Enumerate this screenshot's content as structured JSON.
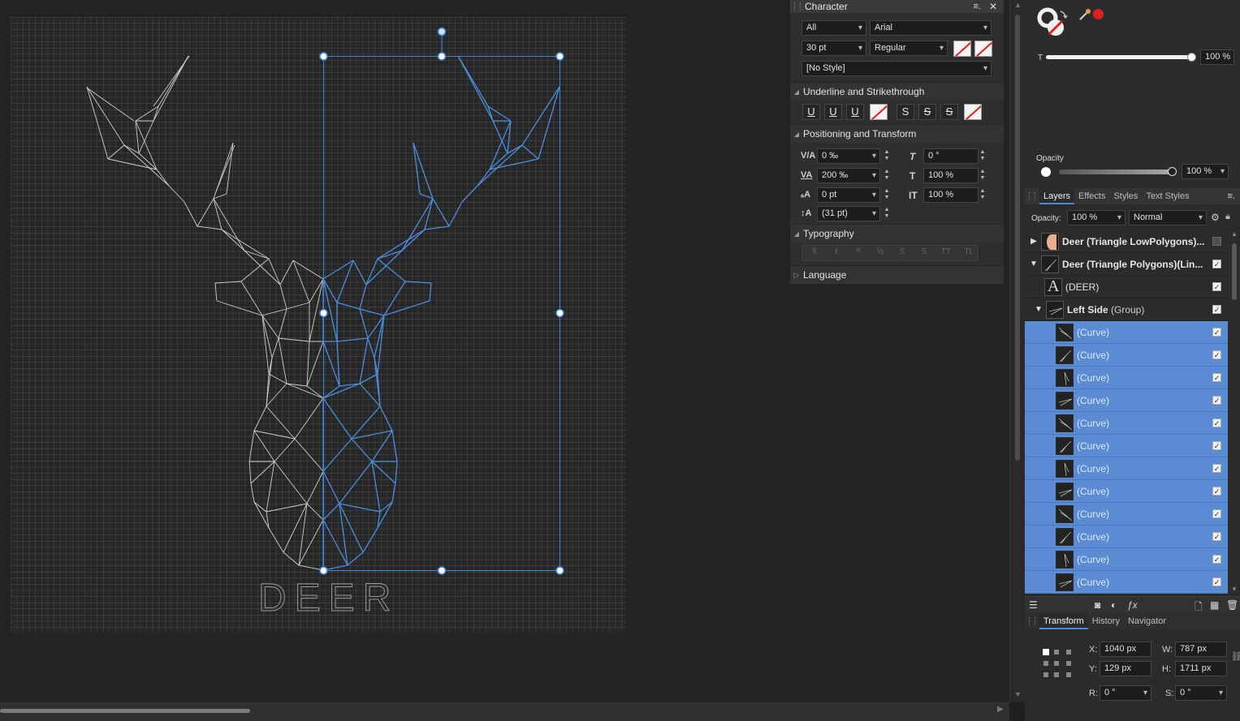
{
  "canvas": {
    "artboard_text": "DEER"
  },
  "character": {
    "title": "Character",
    "scope": "All",
    "font": "Arial",
    "size": "30 pt",
    "weight": "Regular",
    "style": "[No Style]",
    "sections": {
      "underline": "Underline and Strikethrough",
      "positioning": "Positioning and Transform",
      "typography": "Typography",
      "language": "Language"
    },
    "underline_buttons": [
      "U",
      "U",
      "U"
    ],
    "strike_buttons": [
      "S",
      "S",
      "S"
    ],
    "positioning": {
      "tracking": "0 ‰",
      "kerning": "200 ‰",
      "baseline": "0 pt",
      "leading": "(31 pt)",
      "shear": "0 °",
      "vscale": "100 %",
      "hscale": "100 %"
    },
    "typography_buttons": [
      "fi",
      "ℓ",
      "ᴺ",
      "½",
      "S",
      "S",
      "TT",
      "Tt"
    ]
  },
  "color": {
    "accent": "#e02020",
    "tint_label": "T",
    "tint_value": "100 %",
    "tint_level": 1.0,
    "opacity_label": "Opacity",
    "opacity_value": "100 %",
    "opacity_level": 1.0
  },
  "layers": {
    "tabs": [
      "Layers",
      "Effects",
      "Styles",
      "Text Styles"
    ],
    "opacity_label": "Opacity:",
    "opacity_value": "100 %",
    "blend_mode": "Normal",
    "rows": [
      {
        "name": "Deer (Triangle LowPolygons)...",
        "bold": true,
        "expander": "▶",
        "checked": false
      },
      {
        "name": "Deer (Triangle Polygons)(Lin...",
        "bold": true,
        "expander": "▼",
        "checked": true
      },
      {
        "name": "(DEER)",
        "bold": false,
        "expander": "",
        "checked": true
      },
      {
        "name": "Left Side",
        "suffix": " (Group)",
        "bold": true,
        "expander": "▼",
        "checked": true
      },
      {
        "name": "(Curve)",
        "selected": true,
        "checked": true
      },
      {
        "name": "(Curve)",
        "selected": true,
        "checked": true
      },
      {
        "name": "(Curve)",
        "selected": true,
        "checked": true
      },
      {
        "name": "(Curve)",
        "selected": true,
        "checked": true
      },
      {
        "name": "(Curve)",
        "selected": true,
        "checked": true
      },
      {
        "name": "(Curve)",
        "selected": true,
        "checked": true
      },
      {
        "name": "(Curve)",
        "selected": true,
        "checked": true
      },
      {
        "name": "(Curve)",
        "selected": true,
        "checked": true
      },
      {
        "name": "(Curve)",
        "selected": true,
        "checked": true
      },
      {
        "name": "(Curve)",
        "selected": true,
        "checked": true
      },
      {
        "name": "(Curve)",
        "selected": true,
        "checked": true
      },
      {
        "name": "(Curve)",
        "selected": true,
        "checked": true
      }
    ]
  },
  "transform": {
    "tabs": [
      "Transform",
      "History",
      "Navigator"
    ],
    "x_label": "X:",
    "x": "1040 px",
    "y_label": "Y:",
    "y": "129 px",
    "w_label": "W:",
    "w": "787 px",
    "h_label": "H:",
    "h": "1711 px",
    "r_label": "R:",
    "r": "0 °",
    "s_label": "S:",
    "s": "0 °"
  }
}
